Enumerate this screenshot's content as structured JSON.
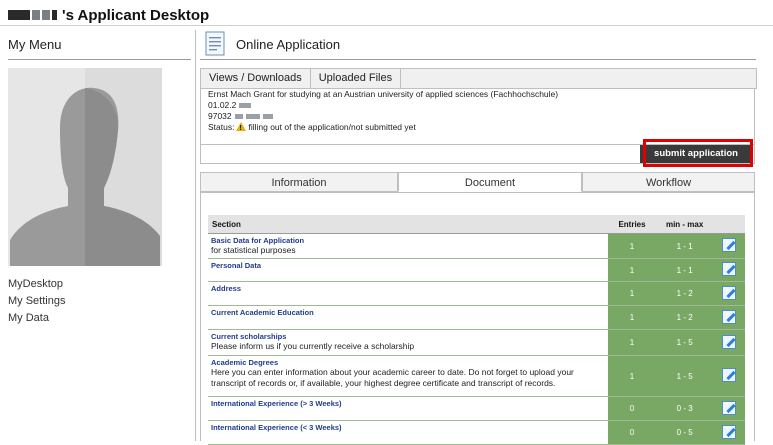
{
  "header": {
    "title": "'s Applicant Desktop"
  },
  "menu": {
    "title": "My Menu",
    "links": [
      "MyDesktop",
      "My Settings",
      "My Data"
    ]
  },
  "main": {
    "title": "Online Application",
    "tabs_top": [
      "Views / Downloads",
      "Uploaded Files"
    ],
    "info": {
      "program": "Ernst Mach Grant for studying at an Austrian university of applied sciences (Fachhochschule)",
      "date": "01.02.2",
      "number": "97032",
      "status_label": "Status:",
      "status_value": "filling out of the application/not submitted yet"
    },
    "submit_label": "submit application",
    "tabs": [
      "Information",
      "Document",
      "Workflow"
    ],
    "active_tab": "Document",
    "table": {
      "headers": [
        "Section",
        "Entries",
        "min - max",
        ""
      ],
      "rows": [
        {
          "title": "Basic Data for Application",
          "desc": "for statistical purposes",
          "entries": "1",
          "range": "1 - 1"
        },
        {
          "title": "Personal Data",
          "desc": "",
          "entries": "1",
          "range": "1 - 1"
        },
        {
          "title": "Address",
          "desc": "",
          "entries": "1",
          "range": "1 - 2"
        },
        {
          "title": "Current Academic Education",
          "desc": "",
          "entries": "1",
          "range": "1 - 2"
        },
        {
          "title": "Current scholarships",
          "desc": "Please inform us if you currently receive a scholarship",
          "entries": "1",
          "range": "1 - 5"
        },
        {
          "title": "Academic Degrees",
          "desc": "Here you can enter information about your academic career to date. Do not forget to upload your transcript of records or, if available, your highest degree certificate and transcript of records.",
          "entries": "1",
          "range": "1 - 5"
        },
        {
          "title": "International Experience (> 3 Weeks)",
          "desc": "",
          "entries": "0",
          "range": "0 - 3"
        },
        {
          "title": "International Experience (< 3 Weeks)",
          "desc": "",
          "entries": "0",
          "range": "0 - 5"
        }
      ]
    }
  },
  "colors": {
    "accent_green": "#79a865",
    "highlight_red": "#e00000",
    "link_blue": "#1f3c8a"
  }
}
